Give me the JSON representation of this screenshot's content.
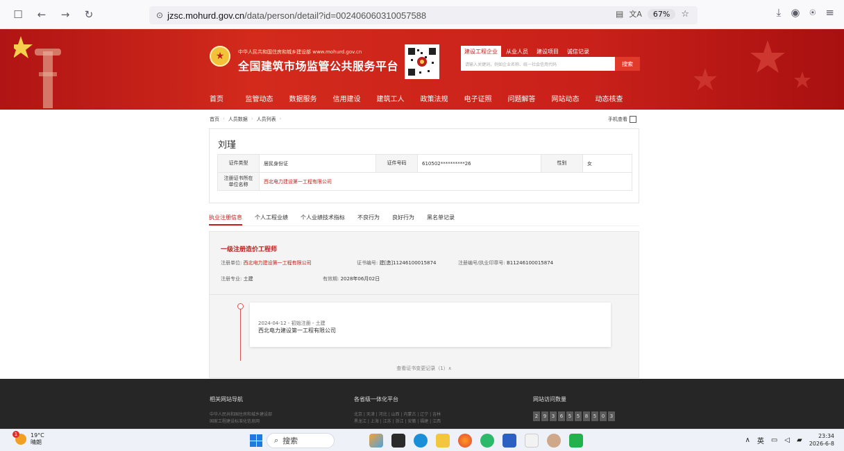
{
  "browser": {
    "url_host": "jzsc.mohurd.gov.cn",
    "url_path": "/data/person/detail?id=002406060310057588",
    "zoom": "67%"
  },
  "site": {
    "subtitle": "中华人民共和国住房和城乡建设部  www.mohurd.gov.cn",
    "title": "全国建筑市场监管公共服务平台",
    "search_tabs": [
      "建设工程企业",
      "从业人员",
      "建设项目",
      "诚信记录"
    ],
    "search_placeholder": "请输入关键词，例如企业名称、统一社会信用代码",
    "search_button": "搜索",
    "nav": [
      "首页",
      "监管动态",
      "数据服务",
      "信用建设",
      "建筑工人",
      "政策法规",
      "电子证照",
      "问题解答",
      "网站动态",
      "动态核查"
    ]
  },
  "breadcrumb": [
    "首页",
    "人员数据",
    "人员列表"
  ],
  "mobile_view": "手机查看",
  "person": {
    "name": "刘瑾",
    "id_type_label": "证件类型",
    "id_type": "居民身份证",
    "id_no_label": "证件号码",
    "id_no": "610502**********26",
    "gender_label": "性别",
    "gender": "女",
    "company_label": "注册证书所在单位名称",
    "company": "西北电力建设第一工程有限公司"
  },
  "tabs": [
    "执业注册信息",
    "个人工程业绩",
    "个人业绩技术指标",
    "不良行为",
    "良好行为",
    "黑名单记录"
  ],
  "registration": {
    "title": "一级注册造价工程师",
    "unit_label": "注册单位:",
    "unit": "西北电力建设第一工程有限公司",
    "cert_label": "证书编号:",
    "cert": "建[造]11246100015874",
    "seal_label": "注册编号/执业印章号:",
    "seal": "B11246100015874",
    "major_label": "注册专业:",
    "major": "土建",
    "valid_label": "有效期:",
    "valid": "2028年06月02日",
    "history_date": "2024-04-12 - 初始注册 - 土建",
    "history_company": "西北电力建设第一工程有限公司",
    "history_toggle": "查看证书变更记录（1）∧"
  },
  "footer": {
    "col1_title": "相关网站导航",
    "col1_links": [
      "中华人民共和国住房和城乡建设部",
      "国家工程建设标准化信息网"
    ],
    "col2_title": "各省级一体化平台",
    "col2_links": [
      "北京 | 天津 | 河北 | 山西 | 内蒙古 | 辽宁 | 吉林",
      "黑龙江 | 上海 | 江苏 | 浙江 | 安徽 | 福建 | 江西"
    ],
    "col3_title": "网站访问数量",
    "counter": [
      "2",
      "9",
      "3",
      "6",
      "5",
      "5",
      "8",
      "5",
      "0",
      "3"
    ]
  },
  "taskbar": {
    "temp": "19°C",
    "weather": "晴朗",
    "badge": "1",
    "search": "搜索",
    "ime": "英",
    "time": "23:34",
    "date": "2026-6-8"
  }
}
